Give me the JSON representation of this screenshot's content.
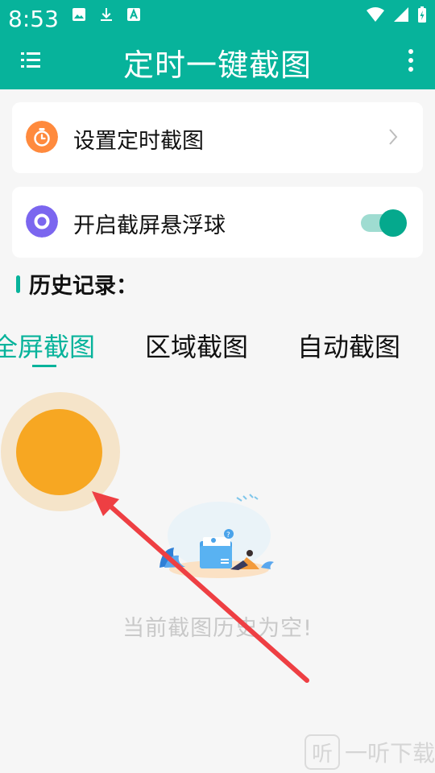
{
  "status_bar": {
    "time": "8:53"
  },
  "header": {
    "title": "定时一键截图"
  },
  "cards": {
    "timed_screenshot": {
      "label": "设置定时截图"
    },
    "floating_ball": {
      "label": "开启截屏悬浮球",
      "enabled": true
    }
  },
  "history": {
    "title": "历史记录：",
    "tabs": [
      {
        "label": "全屏截图",
        "active": true
      },
      {
        "label": "区域截图",
        "active": false
      },
      {
        "label": "自动截图",
        "active": false
      }
    ],
    "empty_text": "当前截图历史为空!"
  },
  "watermark": {
    "glyph": "听",
    "text": "一听下载"
  },
  "colors": {
    "accent": "#07b39b",
    "orange": "#f7a722",
    "purple": "#7b66ef",
    "clock": "#ff8a3d"
  }
}
